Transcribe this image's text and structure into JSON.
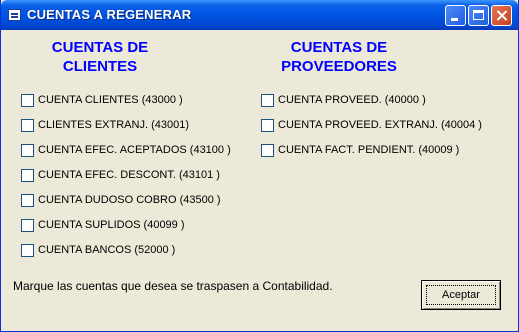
{
  "window": {
    "title": "CUENTAS A REGENERAR",
    "icon": "app-window-icon"
  },
  "clientes": {
    "title_line1": "CUENTAS DE",
    "title_line2": "CLIENTES",
    "items": [
      {
        "label": "CUENTA CLIENTES (43000 )",
        "checked": false
      },
      {
        "label": "CLIENTES EXTRANJ. (43001)",
        "checked": false
      },
      {
        "label": "CUENTA EFEC. ACEPTADOS (43100 )",
        "checked": false
      },
      {
        "label": "CUENTA EFEC. DESCONT. (43101 )",
        "checked": false
      },
      {
        "label": "CUENTA DUDOSO COBRO (43500 )",
        "checked": false
      },
      {
        "label": "CUENTA SUPLIDOS (40099 )",
        "checked": false
      },
      {
        "label": "CUENTA BANCOS (52000 )",
        "checked": false
      }
    ]
  },
  "proveedores": {
    "title_line1": "CUENTAS DE",
    "title_line2": "PROVEEDORES",
    "items": [
      {
        "label": "CUENTA PROVEED. (40000 )",
        "checked": false
      },
      {
        "label": "CUENTA PROVEED. EXTRANJ. (40004 )",
        "checked": false
      },
      {
        "label": "CUENTA FACT. PENDIENT. (40009 )",
        "checked": false
      }
    ]
  },
  "footer": {
    "message": "Marque las cuentas que desea se traspasen a Contabilidad.",
    "accept_label": "Aceptar"
  },
  "colors": {
    "titlebar": "#0054e3",
    "group_title": "#0000ff",
    "window_bg": "#ece9d8"
  }
}
